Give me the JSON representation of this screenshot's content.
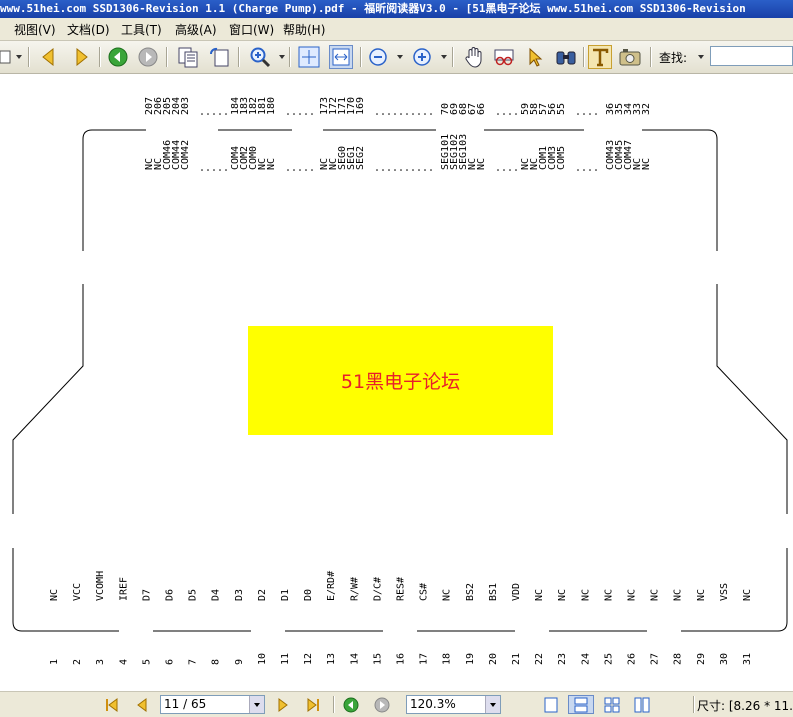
{
  "window": {
    "title": "www.51hei.com SSD1306-Revision 1.1 (Charge Pump).pdf - 福昕阅读器V3.0 - [51黑电子论坛 www.51hei.com SSD1306-Revision"
  },
  "menu": [
    "视图(V)",
    "文档(D)",
    "工具(T)",
    "高级(A)",
    "窗口(W)",
    "帮助(H)"
  ],
  "toolbar": {
    "find_label": "查找:",
    "find_value": "",
    "icons": [
      "back-arrow-icon",
      "forward-arrow-icon",
      "prev-green-icon",
      "next-gray-icon",
      "copy-page-icon",
      "rotate-page-icon",
      "zoom-in-magnifier-icon",
      "fit-page-icon",
      "fit-width-icon",
      "zoom-out-icon",
      "zoom-in-icon",
      "hand-tool-icon",
      "glasses-icon",
      "select-arrow-icon",
      "binoculars-icon",
      "text-select-icon",
      "snapshot-icon"
    ]
  },
  "diagram": {
    "banner": "51黑电子论坛",
    "top_groups": [
      {
        "numbers": [
          "207",
          "206",
          "205",
          "204",
          "203"
        ],
        "labels": [
          "NC",
          "NC",
          "COM46",
          "COM44",
          "COM42"
        ]
      },
      {
        "numbers": [
          "184",
          "183",
          "182",
          "181",
          "180"
        ],
        "labels": [
          "COM4",
          "COM2",
          "COM0",
          "NC",
          "NC"
        ]
      },
      {
        "numbers": [
          "173",
          "172",
          "171",
          "170",
          "169"
        ],
        "labels": [
          "NC",
          "NC",
          "SEG0",
          "SEG1",
          "SEG2"
        ]
      },
      {
        "numbers": [
          "70",
          "69",
          "68",
          "67",
          "66"
        ],
        "labels": [
          "SEG101",
          "SEG102",
          "SEG103",
          "NC",
          "NC"
        ]
      },
      {
        "numbers": [
          "59",
          "58",
          "57",
          "56",
          "55"
        ],
        "labels": [
          "NC",
          "NC",
          "COM1",
          "COM3",
          "COM5"
        ]
      },
      {
        "numbers": [
          "36",
          "35",
          "34",
          "33",
          "32"
        ],
        "labels": [
          "COM43",
          "COM45",
          "COM47",
          "NC",
          "NC"
        ]
      }
    ],
    "bottom_pins": [
      {
        "n": "1",
        "label": "NC"
      },
      {
        "n": "2",
        "label": "VCC"
      },
      {
        "n": "3",
        "label": "VCOMH"
      },
      {
        "n": "4",
        "label": "IREF"
      },
      {
        "n": "5",
        "label": "D7"
      },
      {
        "n": "6",
        "label": "D6"
      },
      {
        "n": "7",
        "label": "D5"
      },
      {
        "n": "8",
        "label": "D4"
      },
      {
        "n": "9",
        "label": "D3"
      },
      {
        "n": "10",
        "label": "D2"
      },
      {
        "n": "11",
        "label": "D1"
      },
      {
        "n": "12",
        "label": "D0"
      },
      {
        "n": "13",
        "label": "E/RD#"
      },
      {
        "n": "14",
        "label": "R/W#"
      },
      {
        "n": "15",
        "label": "D/C#"
      },
      {
        "n": "16",
        "label": "RES#"
      },
      {
        "n": "17",
        "label": "CS#"
      },
      {
        "n": "18",
        "label": "NC"
      },
      {
        "n": "19",
        "label": "BS2"
      },
      {
        "n": "20",
        "label": "BS1"
      },
      {
        "n": "21",
        "label": "VDD"
      },
      {
        "n": "22",
        "label": "NC"
      },
      {
        "n": "23",
        "label": "NC"
      },
      {
        "n": "24",
        "label": "NC"
      },
      {
        "n": "25",
        "label": "NC"
      },
      {
        "n": "26",
        "label": "NC"
      },
      {
        "n": "27",
        "label": "NC"
      },
      {
        "n": "28",
        "label": "NC"
      },
      {
        "n": "29",
        "label": "NC"
      },
      {
        "n": "30",
        "label": "VSS"
      },
      {
        "n": "31",
        "label": "NC"
      }
    ]
  },
  "status": {
    "page_value": "11 / 65",
    "zoom_value": "120.3%",
    "size_text": "尺寸: [8.26 * 11.",
    "icons": [
      "first-page-icon",
      "prev-page-icon",
      "next-page-icon",
      "last-page-icon",
      "history-back-icon",
      "history-forward-icon",
      "single-page-icon",
      "continuous-icon",
      "facing-icon",
      "continuous-facing-icon"
    ]
  }
}
